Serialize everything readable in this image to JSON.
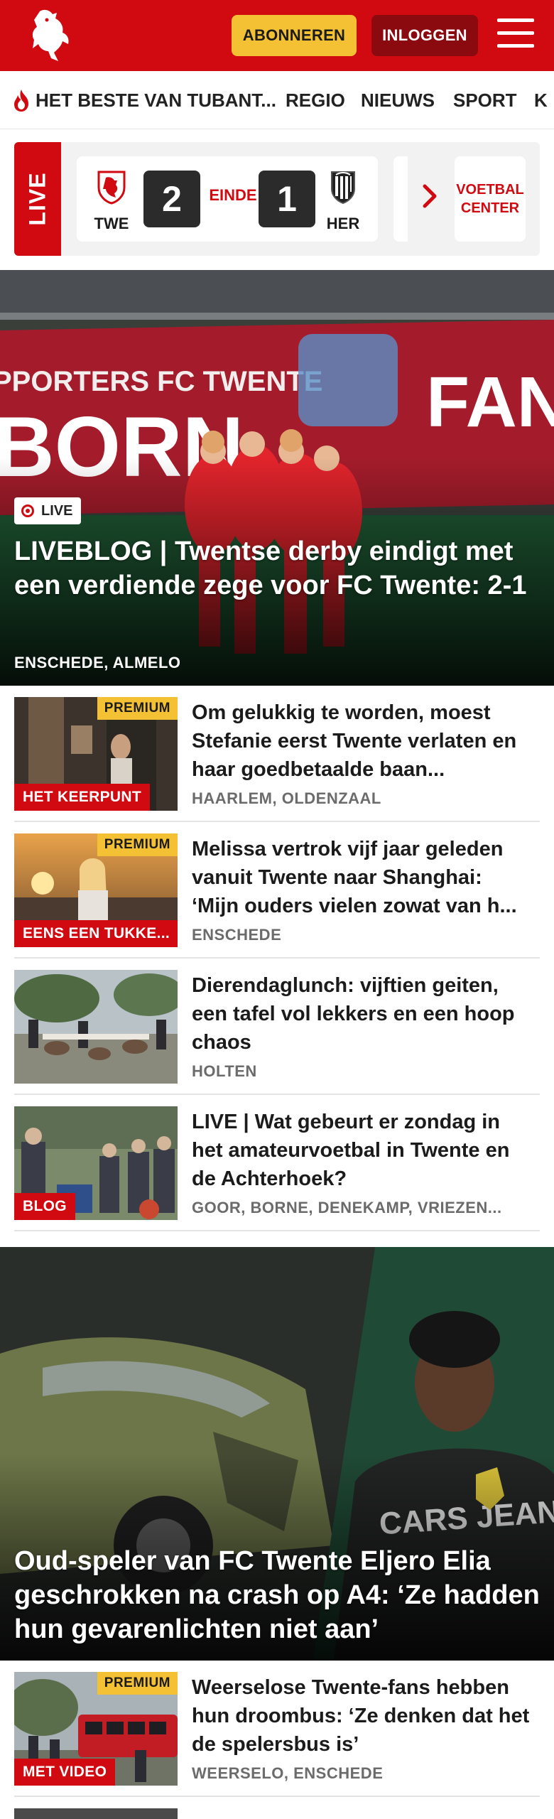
{
  "header": {
    "logo_icon": "tubantia-horse-logo-icon",
    "subscribe_label": "ABONNEREN",
    "login_label": "INLOGGEN",
    "menu_icon": "hamburger-menu-icon",
    "brand_color": "#d10a11",
    "subscribe_color": "#f5c134"
  },
  "nav": {
    "items": [
      {
        "label": "HET BESTE VAN TUBANT...",
        "icon": "flame-icon"
      },
      {
        "label": "REGIO"
      },
      {
        "label": "NIEUWS"
      },
      {
        "label": "SPORT"
      },
      {
        "label": "K"
      }
    ]
  },
  "live_scores": {
    "tab_label": "LIVE",
    "match": {
      "home": "TWE",
      "home_score": "2",
      "status": "EINDE",
      "away_score": "1",
      "away": "HER"
    },
    "next_icon": "chevron-right-icon",
    "center_label_line1": "VOETBAL",
    "center_label_line2": "CENTER"
  },
  "hero": {
    "badge": "LIVE",
    "title": "LIVEBLOG | Twentse derby eindigt met een verdiende zege voor FC Twente: 2-1",
    "location": "ENSCHEDE, ALMELO"
  },
  "articles": [
    {
      "title": "Om gelukkig te worden, moest Stefanie eerst Twente verlaten en haar goedbetaalde baan...",
      "location": "HAARLEM, OLDENZAAL",
      "premium": "PREMIUM",
      "tag": "HET KEERPUNT"
    },
    {
      "title": "Melissa vertrok vijf jaar geleden vanuit Twente naar Shanghai: ‘Mijn ouders vielen zowat van h...",
      "location": "ENSCHEDE",
      "premium": "PREMIUM",
      "tag": "EENS EEN TUKKE..."
    },
    {
      "title": "Dierendaglunch: vijftien geiten, een tafel vol lekkers en een hoop chaos",
      "location": "HOLTEN"
    },
    {
      "title": "LIVE | Wat gebeurt er zondag in het amateurvoetbal in Twente en de Achterhoek?",
      "location": "GOOR, BORNE, DENEKAMP, VRIEZEN...",
      "tag": "BLOG"
    }
  ],
  "feature": {
    "title": "Oud-speler van FC Twente Eljero Elia geschrokken na crash op A4: ‘Ze hadden hun gevarenlichten niet aan’"
  },
  "articles_2": [
    {
      "title": "Weerselose Twente-fans hebben hun droombus: ‘Ze denken dat het de spelersbus is’",
      "location": "WEERSELO, ENSCHEDE",
      "premium": "PREMIUM",
      "tag": "MET VIDEO"
    }
  ]
}
